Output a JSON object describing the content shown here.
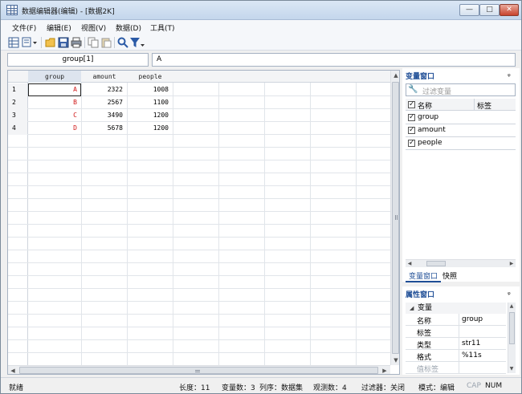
{
  "window": {
    "title": "数据编辑器(编辑) - [数据2K]",
    "btn_min": "—",
    "btn_max": "□",
    "btn_close": "✕"
  },
  "menu": [
    "文件(F)",
    "编辑(E)",
    "视图(V)",
    "数据(D)",
    "工具(T)"
  ],
  "toolbar": [
    "data-editor-icon",
    "copy-icon",
    "open-folder-icon",
    "save-icon",
    "print-icon",
    "copy-icon",
    "paste-icon",
    "search-icon",
    "filter-icon"
  ],
  "cellbar": {
    "name": "group[1]",
    "value": "A"
  },
  "grid": {
    "columns": [
      "group",
      "amount",
      "people"
    ],
    "rows": [
      {
        "n": "1",
        "group": "A",
        "amount": "2322",
        "people": "1008"
      },
      {
        "n": "2",
        "group": "B",
        "amount": "2567",
        "people": "1100"
      },
      {
        "n": "3",
        "group": "C",
        "amount": "3490",
        "people": "1200"
      },
      {
        "n": "4",
        "group": "D",
        "amount": "5678",
        "people": "1200"
      }
    ]
  },
  "vars_panel": {
    "title": "变量窗口",
    "pin": "ᵩ",
    "filter_placeholder": "过滤变量",
    "col_name": "名称",
    "col_label": "标签",
    "items": [
      "group",
      "amount",
      "people"
    ],
    "tabs": [
      "变量窗口",
      "快照"
    ]
  },
  "props_panel": {
    "title": "属性窗口",
    "pin": "ᵩ",
    "group": "变量",
    "rows": [
      {
        "key": "名称",
        "value": "group"
      },
      {
        "key": "标签",
        "value": ""
      },
      {
        "key": "类型",
        "value": "str11"
      },
      {
        "key": "格式",
        "value": "%11s"
      },
      {
        "key": "值标签",
        "value": ""
      }
    ]
  },
  "status": {
    "ready": "就绪",
    "length": "长度：11",
    "vars": "变量数：3",
    "order": "列序：数据集",
    "obs": "观测数：4",
    "filter": "过滤器：关闭",
    "mode": "模式：编辑",
    "cap": "CAP",
    "num": "NUM"
  },
  "colors": {
    "accent": "#1f4e96",
    "string_value": "#d01818"
  }
}
